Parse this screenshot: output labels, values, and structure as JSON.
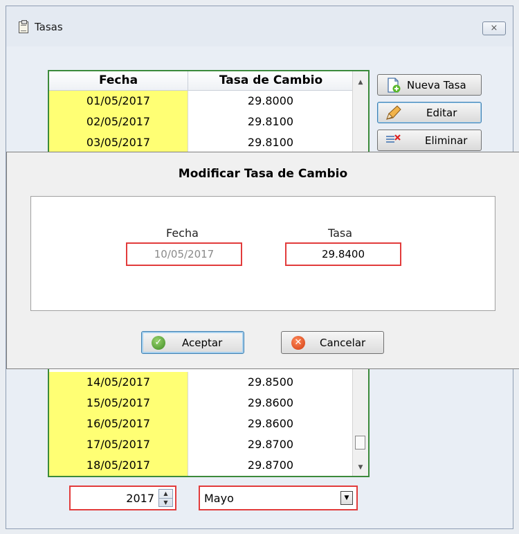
{
  "window": {
    "title": "Tasas",
    "close_label": "⨯"
  },
  "grid": {
    "headers": {
      "fecha": "Fecha",
      "tasa": "Tasa de Cambio"
    },
    "rows_top": [
      {
        "fecha": "01/05/2017",
        "tasa": "29.8000"
      },
      {
        "fecha": "02/05/2017",
        "tasa": "29.8100"
      },
      {
        "fecha": "03/05/2017",
        "tasa": "29.8100"
      }
    ],
    "rows_bottom": [
      {
        "fecha": "14/05/2017",
        "tasa": "29.8500"
      },
      {
        "fecha": "15/05/2017",
        "tasa": "29.8600"
      },
      {
        "fecha": "16/05/2017",
        "tasa": "29.8600"
      },
      {
        "fecha": "17/05/2017",
        "tasa": "29.8700"
      },
      {
        "fecha": "18/05/2017",
        "tasa": "29.8700"
      }
    ],
    "scroll_up": "▲",
    "scroll_down": "▼"
  },
  "side_buttons": {
    "nueva": "Nueva Tasa",
    "editar": "Editar",
    "eliminar": "Eliminar"
  },
  "dialog": {
    "title": "Modificar Tasa de Cambio",
    "fecha_label": "Fecha",
    "fecha_value": "10/05/2017",
    "tasa_label": "Tasa",
    "tasa_value": "29.8400",
    "accept": "Aceptar",
    "cancel": "Cancelar"
  },
  "filters": {
    "year": "2017",
    "month": "Mayo",
    "spin_up": "▲",
    "spin_down": "▼",
    "dropdown_arrow": "▼"
  },
  "colors": {
    "fecha_column": "#ffff74",
    "grid_border": "#3b8a3b",
    "invalid_border": "#e23b3b"
  }
}
